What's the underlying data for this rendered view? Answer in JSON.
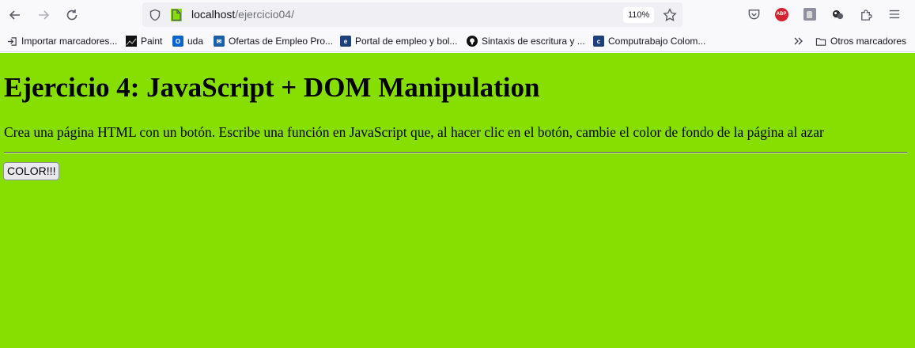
{
  "browser": {
    "url_host": "localhost",
    "url_path": "/ejercicio04/",
    "zoom": "110%"
  },
  "bookmarks": [
    {
      "label": "Importar marcadores...",
      "icon": "import-icon"
    },
    {
      "label": "Paint",
      "icon": "paint-icon"
    },
    {
      "label": "uda",
      "icon": "outlook-icon"
    },
    {
      "label": "Ofertas de Empleo Pro...",
      "icon": "mail-icon"
    },
    {
      "label": "Portal de empleo y bol...",
      "icon": "portal-icon"
    },
    {
      "label": "Sintaxis de escritura y ...",
      "icon": "github-icon"
    },
    {
      "label": "Computrabajo Colom...",
      "icon": "computrabajo-icon"
    }
  ],
  "other_bookmarks": "Otros marcadores",
  "page": {
    "title": "Ejercicio 4: JavaScript + DOM Manipulation",
    "description": "Crea una página HTML con un botón. Escribe una función en JavaScript que, al hacer clic en el botón, cambie el color de fondo de la página al azar",
    "button_label": "COLOR!!!",
    "background_color": "#86df00"
  }
}
